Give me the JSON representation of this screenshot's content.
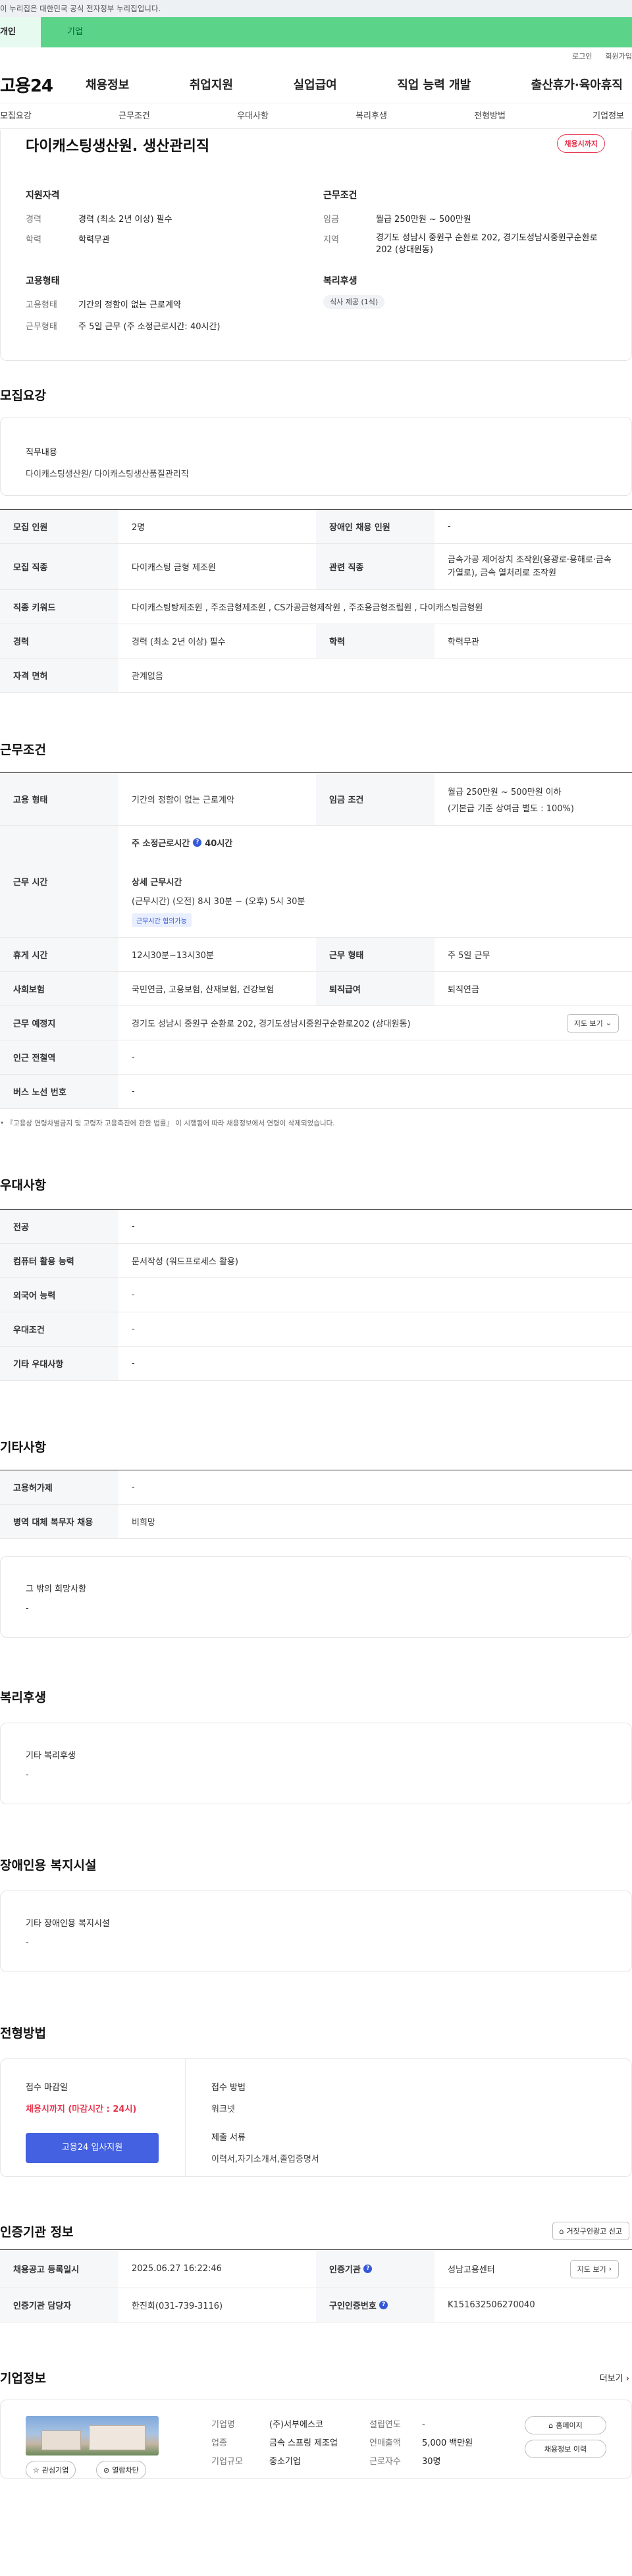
{
  "gov_banner": "이 누리집은 대한민국 공식 전자정부 누리집입니다.",
  "user_tabs": {
    "personal": "개인",
    "company": "기업"
  },
  "util": {
    "login": "로그인",
    "join": "회원가입"
  },
  "gnb": {
    "logo": "고용24",
    "items": [
      "채용정보",
      "취업지원",
      "실업급여",
      "직업 능력 개발",
      "출산휴가·육아휴직"
    ]
  },
  "subnav": [
    "모집요강",
    "근무조건",
    "우대사항",
    "복리후생",
    "전형방법",
    "기업정보"
  ],
  "summary": {
    "title": "다이캐스팅생산원. 생산관리직",
    "status_badge": "채용시까지",
    "qual_title": "지원자격",
    "qual_rows": [
      {
        "k": "경력",
        "v": "경력 (최소 2년 이상) 필수"
      },
      {
        "k": "학력",
        "v": "학력무관"
      }
    ],
    "cond_title": "근무조건",
    "cond_rows": [
      {
        "k": "임금",
        "v": "월급 250만원 ~ 500만원"
      },
      {
        "k": "지역",
        "v": "경기도 성남시 중원구 순환로 202, 경기도성남시중원구순환로202 (상대원동)"
      }
    ],
    "emp_title": "고용형태",
    "emp_rows": [
      {
        "k": "고용형태",
        "v": "기간의 정함이 없는 근로계약"
      },
      {
        "k": "근무형태",
        "v": "주 5일 근무 (주 소정근로시간: 40시간)"
      }
    ],
    "welfare_title": "복리후생",
    "welfare_chip": "식사 제공 (1식)"
  },
  "recruit": {
    "section_title": "모집요강",
    "job_box_title": "직무내용",
    "job_box_text": "다이캐스팅생산원/ 다이캐스팅생산품질관리직",
    "rows": [
      {
        "k1": "모집 인원",
        "v1": "2명",
        "k2": "장애인 채용 인원",
        "v2": "-"
      },
      {
        "k1": "모집 직종",
        "v1": "다이캐스팅 금형 제조원",
        "k2": "관련 직종",
        "v2": "금속가공 제어장치 조작원(용광로·용해로·금속가열로), 금속 열처리로 조작원"
      },
      {
        "k1": "직종 키워드",
        "v1": "다이캐스팅탕제조원 , 주조금형제조원 , CS가공금형제작원 , 주조용금형조립원 , 다이캐스팅금형원"
      },
      {
        "k1": "경력",
        "v1": "경력 (최소 2년 이상) 필수",
        "k2": "학력",
        "v2": "학력무관"
      },
      {
        "k1": "자격 면허",
        "v1": "관계없음"
      }
    ]
  },
  "work": {
    "section_title": "근무조건",
    "emp_k": "고용 형태",
    "emp_v": "기간의 정함이 없는 근로계약",
    "wage_k": "임금 조건",
    "wage_v1": "월급 250만원 ~ 500만원 이하",
    "wage_v2": "(기본급 기준 상여금 별도 : 100%)",
    "hours_k": "근무 시간",
    "hours_total_label": "주 소정근로시간",
    "hours_total_value": "40시간",
    "hours_detail_label": "상세 근무시간",
    "hours_detail_value": "(근무시간) (오전) 8시 30분 ~ (오후) 5시 30분",
    "hours_tag": "근무시간 협의가능",
    "rest_k": "휴게 시간",
    "rest_v": "12시30분~13시30분",
    "shift_k": "근무 형태",
    "shift_v": "주 5일 근무",
    "ins_k": "사회보험",
    "ins_v": "국민연금, 고용보험, 산재보험, 건강보험",
    "sev_k": "퇴직급여",
    "sev_v": "퇴직연금",
    "place_k": "근무 예정지",
    "place_v": "경기도 성남시 중원구 순환로 202, 경기도성남시중원구순환로202 (상대원동)",
    "map_btn": "지도 보기",
    "station_k": "인근 전철역",
    "station_v": "-",
    "bus_k": "버스 노선 번호",
    "bus_v": "-",
    "note": "『고용상 연령차별금지 및 고령자 고용촉진에 관한 법률』 이 시행됨에 따라 채용정보에서 연령이 삭제되었습니다."
  },
  "pref": {
    "section_title": "우대사항",
    "rows": [
      {
        "k": "전공",
        "v": "-"
      },
      {
        "k": "컴퓨터 활용 능력",
        "v": "문서작성 (워드프로세스 활용)"
      },
      {
        "k": "외국어 능력",
        "v": "-"
      },
      {
        "k": "우대조건",
        "v": "-"
      },
      {
        "k": "기타 우대사항",
        "v": "-"
      }
    ]
  },
  "etc": {
    "section_title": "기타사항",
    "rows": [
      {
        "k": "고용허가제",
        "v": "-"
      },
      {
        "k": "병역 대체 복무자 채용",
        "v": "비희망"
      }
    ],
    "box_title": "그 밖의 희망사항",
    "box_text": "-"
  },
  "welfare": {
    "section_title": "복리후생",
    "box_title": "기타 복리후생",
    "box_text": "-"
  },
  "disabled": {
    "section_title": "장애인용 복지시설",
    "box_title": "기타 장애인용 복지시설",
    "box_text": "-"
  },
  "selection": {
    "section_title": "전형방법",
    "deadline_label": "접수 마감일",
    "deadline_value": "채용시까지 (마감시간 : 24시)",
    "apply_btn": "고용24 입사지원",
    "method_label": "접수 방법",
    "method_value": "워크넷",
    "docs_label": "제출 서류",
    "docs_value": "이력서,자기소개서,졸업증명서"
  },
  "cert": {
    "section_title": "인증기관 정보",
    "report_btn": "거짓구인광고 신고",
    "reg_k": "채용공고 등록일시",
    "reg_v": "2025.06.27 16:22:46",
    "org_k": "인증기관",
    "org_v": "성남고용센터",
    "map_btn": "지도 보기",
    "mgr_k": "인증기관 담당자",
    "mgr_v": "한진희(031-739-3116)",
    "no_k": "구인인증번호",
    "no_v": "K151632506270040"
  },
  "company": {
    "section_title": "기업정보",
    "more": "더보기",
    "fav": "관심기업",
    "block": "열람차단",
    "name_k": "기업명",
    "name_v": "(주)서부에스코",
    "ind_k": "업종",
    "ind_v": "금속 스프링 제조업",
    "size_k": "기업규모",
    "size_v": "중소기업",
    "year_k": "설립연도",
    "year_v": "-",
    "sales_k": "연매출액",
    "sales_v": "5,000 백만원",
    "emp_k": "근로자수",
    "emp_v": "30명",
    "home_btn": "홈페이지",
    "history_btn": "채용정보 이력"
  },
  "colors": {
    "accent": "#3558d8",
    "brand_green": "#5bd48a",
    "status_red": "#e8344e"
  }
}
